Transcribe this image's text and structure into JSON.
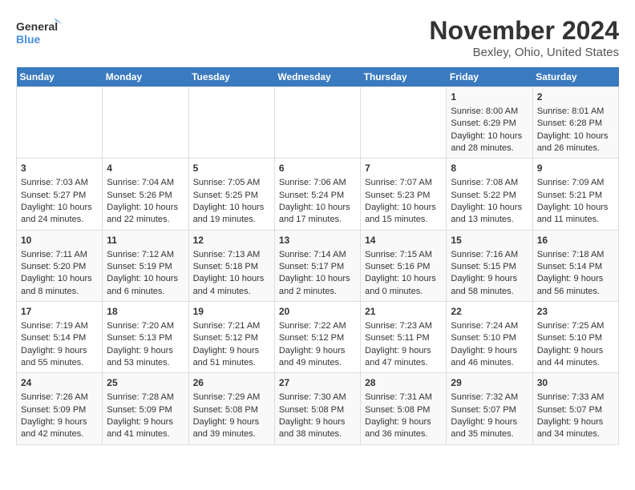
{
  "logo": {
    "line1": "General",
    "line2": "Blue"
  },
  "title": "November 2024",
  "location": "Bexley, Ohio, United States",
  "weekdays": [
    "Sunday",
    "Monday",
    "Tuesday",
    "Wednesday",
    "Thursday",
    "Friday",
    "Saturday"
  ],
  "weeks": [
    [
      {
        "day": "",
        "text": ""
      },
      {
        "day": "",
        "text": ""
      },
      {
        "day": "",
        "text": ""
      },
      {
        "day": "",
        "text": ""
      },
      {
        "day": "",
        "text": ""
      },
      {
        "day": "1",
        "text": "Sunrise: 8:00 AM\nSunset: 6:29 PM\nDaylight: 10 hours and 28 minutes."
      },
      {
        "day": "2",
        "text": "Sunrise: 8:01 AM\nSunset: 6:28 PM\nDaylight: 10 hours and 26 minutes."
      }
    ],
    [
      {
        "day": "3",
        "text": "Sunrise: 7:03 AM\nSunset: 5:27 PM\nDaylight: 10 hours and 24 minutes."
      },
      {
        "day": "4",
        "text": "Sunrise: 7:04 AM\nSunset: 5:26 PM\nDaylight: 10 hours and 22 minutes."
      },
      {
        "day": "5",
        "text": "Sunrise: 7:05 AM\nSunset: 5:25 PM\nDaylight: 10 hours and 19 minutes."
      },
      {
        "day": "6",
        "text": "Sunrise: 7:06 AM\nSunset: 5:24 PM\nDaylight: 10 hours and 17 minutes."
      },
      {
        "day": "7",
        "text": "Sunrise: 7:07 AM\nSunset: 5:23 PM\nDaylight: 10 hours and 15 minutes."
      },
      {
        "day": "8",
        "text": "Sunrise: 7:08 AM\nSunset: 5:22 PM\nDaylight: 10 hours and 13 minutes."
      },
      {
        "day": "9",
        "text": "Sunrise: 7:09 AM\nSunset: 5:21 PM\nDaylight: 10 hours and 11 minutes."
      }
    ],
    [
      {
        "day": "10",
        "text": "Sunrise: 7:11 AM\nSunset: 5:20 PM\nDaylight: 10 hours and 8 minutes."
      },
      {
        "day": "11",
        "text": "Sunrise: 7:12 AM\nSunset: 5:19 PM\nDaylight: 10 hours and 6 minutes."
      },
      {
        "day": "12",
        "text": "Sunrise: 7:13 AM\nSunset: 5:18 PM\nDaylight: 10 hours and 4 minutes."
      },
      {
        "day": "13",
        "text": "Sunrise: 7:14 AM\nSunset: 5:17 PM\nDaylight: 10 hours and 2 minutes."
      },
      {
        "day": "14",
        "text": "Sunrise: 7:15 AM\nSunset: 5:16 PM\nDaylight: 10 hours and 0 minutes."
      },
      {
        "day": "15",
        "text": "Sunrise: 7:16 AM\nSunset: 5:15 PM\nDaylight: 9 hours and 58 minutes."
      },
      {
        "day": "16",
        "text": "Sunrise: 7:18 AM\nSunset: 5:14 PM\nDaylight: 9 hours and 56 minutes."
      }
    ],
    [
      {
        "day": "17",
        "text": "Sunrise: 7:19 AM\nSunset: 5:14 PM\nDaylight: 9 hours and 55 minutes."
      },
      {
        "day": "18",
        "text": "Sunrise: 7:20 AM\nSunset: 5:13 PM\nDaylight: 9 hours and 53 minutes."
      },
      {
        "day": "19",
        "text": "Sunrise: 7:21 AM\nSunset: 5:12 PM\nDaylight: 9 hours and 51 minutes."
      },
      {
        "day": "20",
        "text": "Sunrise: 7:22 AM\nSunset: 5:12 PM\nDaylight: 9 hours and 49 minutes."
      },
      {
        "day": "21",
        "text": "Sunrise: 7:23 AM\nSunset: 5:11 PM\nDaylight: 9 hours and 47 minutes."
      },
      {
        "day": "22",
        "text": "Sunrise: 7:24 AM\nSunset: 5:10 PM\nDaylight: 9 hours and 46 minutes."
      },
      {
        "day": "23",
        "text": "Sunrise: 7:25 AM\nSunset: 5:10 PM\nDaylight: 9 hours and 44 minutes."
      }
    ],
    [
      {
        "day": "24",
        "text": "Sunrise: 7:26 AM\nSunset: 5:09 PM\nDaylight: 9 hours and 42 minutes."
      },
      {
        "day": "25",
        "text": "Sunrise: 7:28 AM\nSunset: 5:09 PM\nDaylight: 9 hours and 41 minutes."
      },
      {
        "day": "26",
        "text": "Sunrise: 7:29 AM\nSunset: 5:08 PM\nDaylight: 9 hours and 39 minutes."
      },
      {
        "day": "27",
        "text": "Sunrise: 7:30 AM\nSunset: 5:08 PM\nDaylight: 9 hours and 38 minutes."
      },
      {
        "day": "28",
        "text": "Sunrise: 7:31 AM\nSunset: 5:08 PM\nDaylight: 9 hours and 36 minutes."
      },
      {
        "day": "29",
        "text": "Sunrise: 7:32 AM\nSunset: 5:07 PM\nDaylight: 9 hours and 35 minutes."
      },
      {
        "day": "30",
        "text": "Sunrise: 7:33 AM\nSunset: 5:07 PM\nDaylight: 9 hours and 34 minutes."
      }
    ]
  ]
}
